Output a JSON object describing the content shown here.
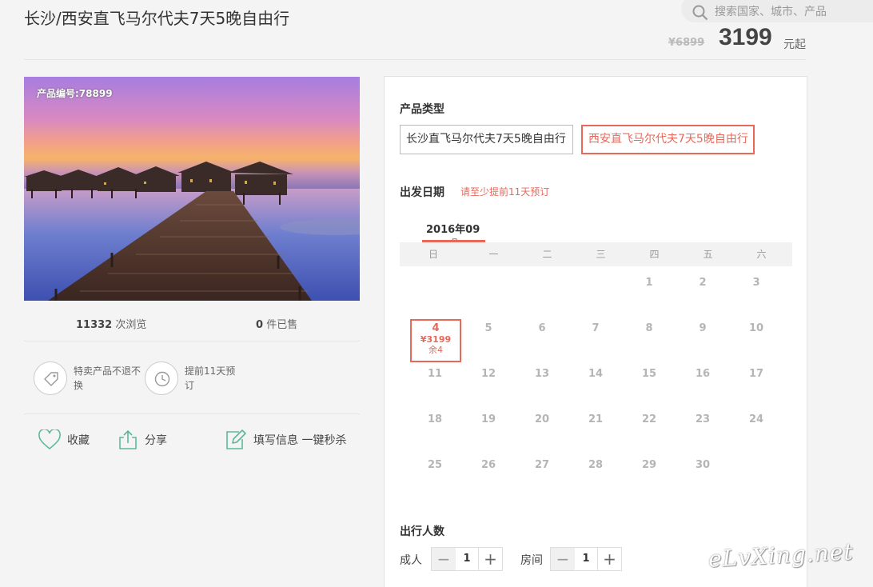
{
  "header": {
    "title": "长沙/西安直飞马尔代夫7天5晚自由行",
    "search_placeholder": "搜索国家、城市、产品",
    "old_price": "¥6899",
    "price": "3199",
    "price_unit": "元起"
  },
  "product": {
    "image_code": "产品编号:78899",
    "views_count": "11332",
    "views_label": "次浏览",
    "sold_count": "0",
    "sold_label": "件已售",
    "tips": [
      {
        "text": "特卖产品不退不换",
        "icon": "tag-icon"
      },
      {
        "text": "提前11天预订",
        "icon": "clock-icon"
      }
    ],
    "actions": {
      "favorite": "收藏",
      "share": "分享",
      "fill_info": "填写信息 一键秒杀"
    }
  },
  "booking": {
    "type_label": "产品类型",
    "types": [
      {
        "label": "长沙直飞马尔代夫7天5晚自由行",
        "selected": false
      },
      {
        "label": "西安直飞马尔代夫7天5晚自由行",
        "selected": true
      }
    ],
    "date_label": "出发日期",
    "date_hint": "请至少提前11天预订",
    "calendar": {
      "month_label": "2016年09",
      "month_sub": "月",
      "weekdays": [
        "日",
        "一",
        "二",
        "三",
        "四",
        "五",
        "六"
      ],
      "days": [
        "1",
        "2",
        "3",
        "5",
        "6",
        "7",
        "8",
        "9",
        "10",
        "11",
        "12",
        "13",
        "14",
        "15",
        "16",
        "17",
        "18",
        "19",
        "20",
        "21",
        "22",
        "23",
        "24",
        "25",
        "26",
        "27",
        "28",
        "29",
        "30"
      ],
      "selected_day": {
        "day": "4",
        "price": "¥3199",
        "remaining": "余4"
      }
    },
    "people_label": "出行人数",
    "adult_label": "成人",
    "adult_value": "1",
    "room_label": "房间",
    "room_value": "1"
  },
  "watermark": "eLvXing.net",
  "colors": {
    "accent": "#e8685a",
    "green_icon": "#5bb99a"
  }
}
